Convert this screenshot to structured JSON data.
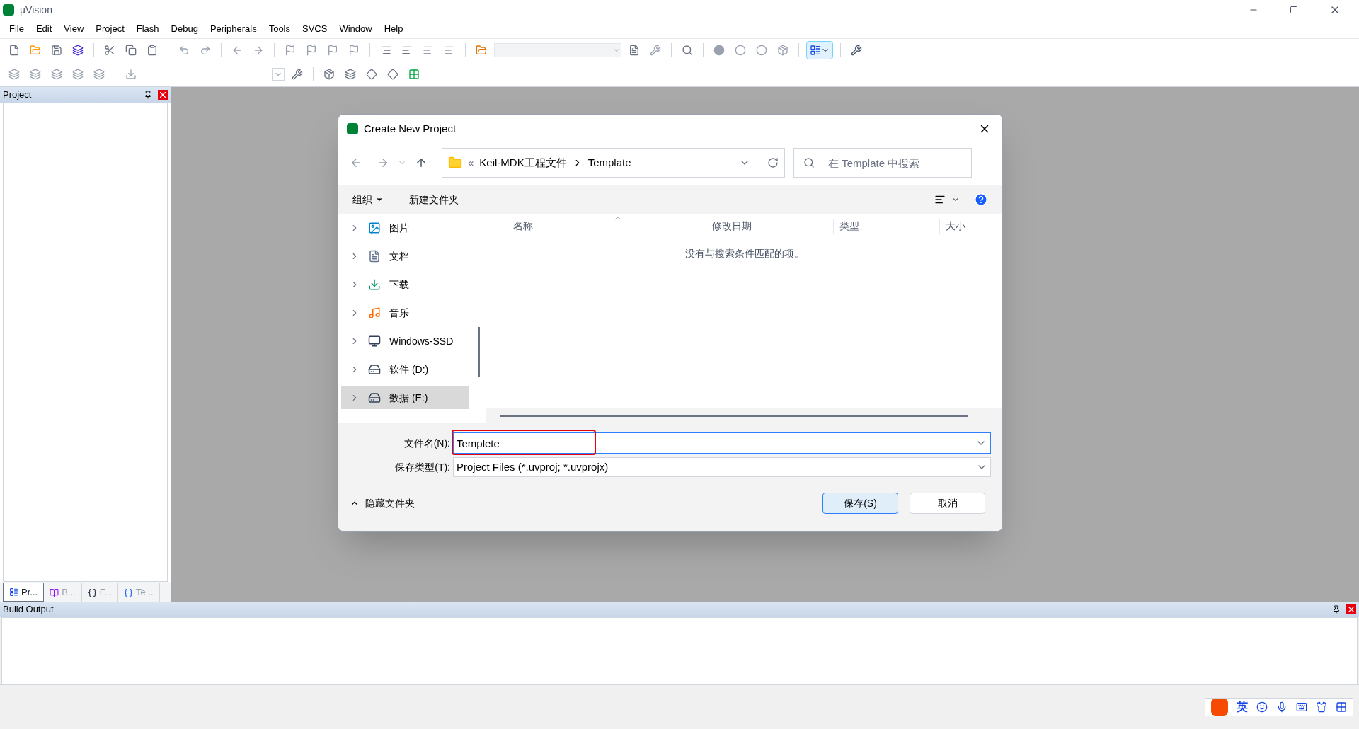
{
  "window": {
    "title": "µVision"
  },
  "menu": [
    "File",
    "Edit",
    "View",
    "Project",
    "Flash",
    "Debug",
    "Peripherals",
    "Tools",
    "SVCS",
    "Window",
    "Help"
  ],
  "project_panel": {
    "title": "Project",
    "tabs": [
      {
        "label": "Pr...",
        "selected": true,
        "kind": "project"
      },
      {
        "label": "B...",
        "selected": false,
        "kind": "books"
      },
      {
        "label": "F...",
        "selected": false,
        "kind": "functions"
      },
      {
        "label": "Te...",
        "selected": false,
        "kind": "templates"
      }
    ]
  },
  "dialog": {
    "title": "Create New Project",
    "path_overflow": "«",
    "path": [
      "Keil-MDK工程文件",
      "Template"
    ],
    "search": {
      "placeholder": "在 Template 中搜索"
    },
    "commands": [
      "组织",
      "新建文件夹"
    ],
    "tree": [
      {
        "label": "图片",
        "kind": "pictures",
        "selected": false
      },
      {
        "label": "文档",
        "kind": "documents",
        "selected": false
      },
      {
        "label": "下载",
        "kind": "downloads",
        "selected": false
      },
      {
        "label": "音乐",
        "kind": "music",
        "selected": false
      },
      {
        "label": "Windows-SSD",
        "kind": "system",
        "selected": false
      },
      {
        "label": "软件 (D:)",
        "kind": "drive",
        "selected": false
      },
      {
        "label": "数据 (E:)",
        "kind": "drive",
        "selected": true
      }
    ],
    "columns": [
      "名称",
      "修改日期",
      "类型",
      "大小"
    ],
    "empty_message": "没有与搜索条件匹配的项。",
    "filename": {
      "label": "文件名(N):",
      "value": "Templete"
    },
    "filetype": {
      "label": "保存类型(T):",
      "value": "Project Files (*.uvproj; *.uvprojx)"
    },
    "hide_folders": "隐藏文件夹",
    "buttons": [
      "保存(S)",
      "取消"
    ]
  },
  "build_output": {
    "title": "Build Output"
  },
  "ime": {
    "mode": "英"
  }
}
